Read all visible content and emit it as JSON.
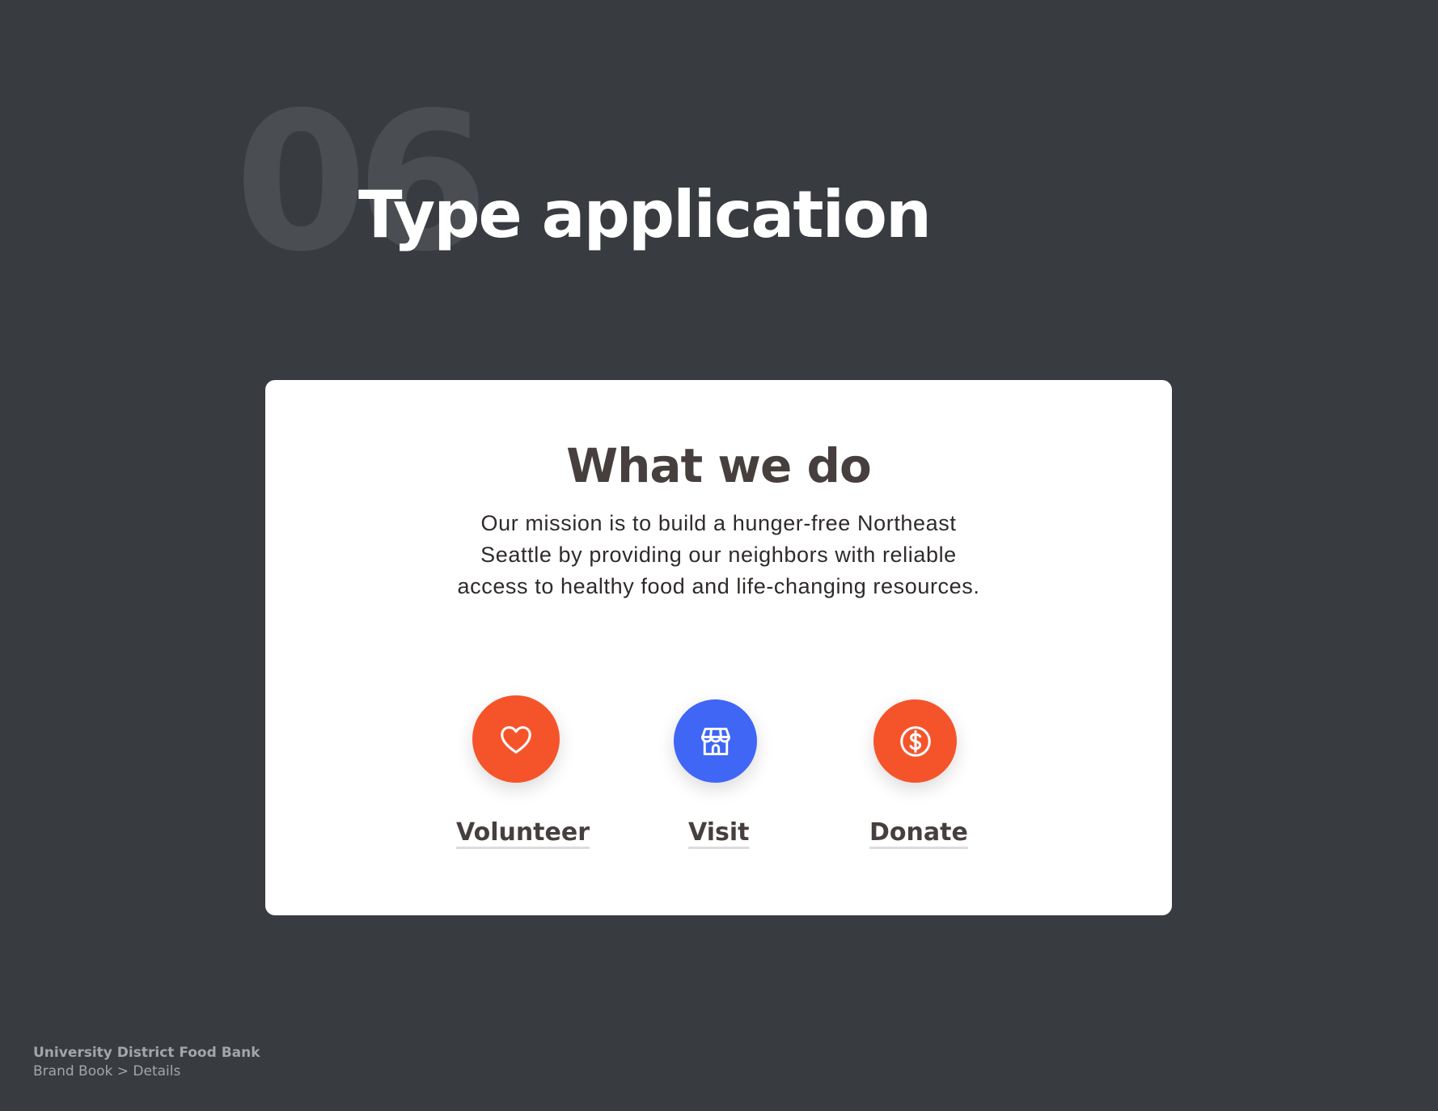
{
  "section": {
    "number": "06",
    "title": "Type application"
  },
  "card": {
    "title": "What we do",
    "mission_lines": [
      "Our mission is to build a hunger-free Northeast",
      "Seattle by providing our neighbors with reliable",
      "access to healthy food and life-changing resources."
    ],
    "actions": [
      {
        "label": "Volunteer",
        "icon": "heart-icon",
        "color": "#f5542b"
      },
      {
        "label": "Visit",
        "icon": "storefront-icon",
        "color": "#3f66f5"
      },
      {
        "label": "Donate",
        "icon": "dollar-coin-icon",
        "color": "#f5542b"
      }
    ]
  },
  "footer": {
    "organization": "University District Food Bank",
    "breadcrumb": "Brand Book > Details"
  }
}
